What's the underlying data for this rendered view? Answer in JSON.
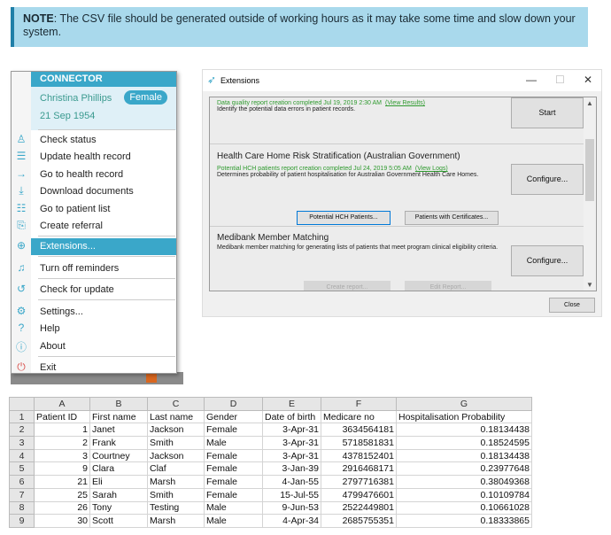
{
  "note": {
    "label": "NOTE",
    "text": ": The CSV file should be generated outside of working hours as it may take some time and slow down your system."
  },
  "menu": {
    "header": "CONNECTOR",
    "patient_name": "Christina Phillips",
    "gender": "Female",
    "dob": "21 Sep 1954",
    "items": [
      {
        "label": "Check status",
        "icon": "person-icon"
      },
      {
        "label": "Update health record",
        "icon": "list-add-icon"
      },
      {
        "label": "Go to health record",
        "icon": "arrow-right-icon"
      },
      {
        "label": "Download documents",
        "icon": "download-icon"
      },
      {
        "label": "Go to patient list",
        "icon": "list-icon"
      },
      {
        "label": "Create referral",
        "icon": "document-add-icon"
      },
      {
        "label": "Extensions...",
        "icon": "plus-circle-icon"
      },
      {
        "label": "Turn off reminders",
        "icon": "bell-icon"
      },
      {
        "label": "Check for update",
        "icon": "refresh-icon"
      },
      {
        "label": "Settings...",
        "icon": "gear-icon"
      },
      {
        "label": "Help",
        "icon": "help-icon"
      },
      {
        "label": "About",
        "icon": "info-icon"
      },
      {
        "label": "Exit",
        "icon": "power-icon"
      }
    ],
    "highlight_color": "#3aa7c9"
  },
  "dialog": {
    "title": "Extensions",
    "dq": {
      "status": "Data quality report creation completed Jul 19, 2019 2:30 AM",
      "link": "(View Results)",
      "desc": "Identify the potential data errors in patient records.",
      "button": "Start"
    },
    "hch": {
      "title": "Health Care Home Risk Stratification (Australian Government)",
      "status": "Potential HCH patients report creation completed Jul 24, 2019 5:05 AM",
      "link": "(View Logs)",
      "desc": "Determines probability of patient hospitalisation for Australian Government Health Care Homes.",
      "button": "Configure...",
      "btn1": "Potential HCH Patients...",
      "btn2": "Patients with Certificates..."
    },
    "mb": {
      "title": "Medibank Member Matching",
      "desc": "Medibank member matching for generating lists of patients that meet program clinical eligibility criteria.",
      "button": "Configure...",
      "btn1": "Create report...",
      "btn2": "Edit Report..."
    },
    "close": "Close"
  },
  "sheet": {
    "columns": [
      "A",
      "B",
      "C",
      "D",
      "E",
      "F",
      "G"
    ],
    "headers": [
      "Patient ID",
      "First name",
      "Last name",
      "Gender",
      "Date of birth",
      "Medicare no",
      "Hospitalisation Probability"
    ],
    "rows": [
      [
        "1",
        "Janet",
        "Jackson",
        "Female",
        "3-Apr-31",
        "3634564181",
        "0.18134438"
      ],
      [
        "2",
        "Frank",
        "Smith",
        "Male",
        "3-Apr-31",
        "5718581831",
        "0.18524595"
      ],
      [
        "3",
        "Courtney",
        "Jackson",
        "Female",
        "3-Apr-31",
        "4378152401",
        "0.18134438"
      ],
      [
        "9",
        "Clara",
        "Claf",
        "Female",
        "3-Jan-39",
        "2916468171",
        "0.23977648"
      ],
      [
        "21",
        "Eli",
        "Marsh",
        "Female",
        "4-Jan-55",
        "2797716381",
        "0.38049368"
      ],
      [
        "25",
        "Sarah",
        "Smith",
        "Female",
        "15-Jul-55",
        "4799476601",
        "0.10109784"
      ],
      [
        "26",
        "Tony",
        "Testing",
        "Male",
        "9-Jun-53",
        "2522449801",
        "0.10661028"
      ],
      [
        "30",
        "Scott",
        "Marsh",
        "Male",
        "4-Apr-34",
        "2685755351",
        "0.18333865"
      ]
    ]
  }
}
